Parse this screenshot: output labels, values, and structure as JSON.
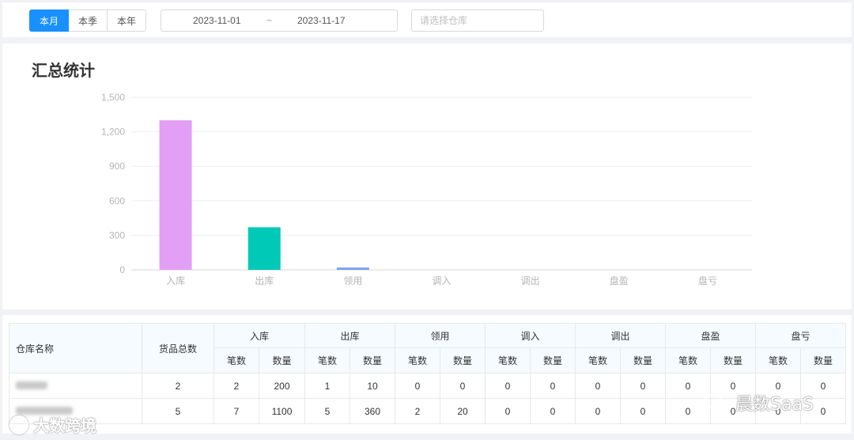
{
  "toolbar": {
    "periods": [
      {
        "label": "本月",
        "active": true
      },
      {
        "label": "本季",
        "active": false
      },
      {
        "label": "本年",
        "active": false
      }
    ],
    "date_start": "2023-11-01",
    "date_separator": "~",
    "date_end": "2023-11-17",
    "warehouse_placeholder": "请选择仓库"
  },
  "summary": {
    "title": "汇总统计"
  },
  "chart_data": {
    "type": "bar",
    "categories": [
      "入库",
      "出库",
      "领用",
      "调入",
      "调出",
      "盘盈",
      "盘亏"
    ],
    "values": [
      1300,
      370,
      20,
      0,
      0,
      0,
      0
    ],
    "colors": [
      "#e39ff6",
      "#00c9b8",
      "#7e9ff2",
      "#e39ff6",
      "#e39ff6",
      "#e39ff6",
      "#e39ff6"
    ],
    "ylim": [
      0,
      1500
    ],
    "yticks": [
      0,
      300,
      600,
      900,
      1200,
      1500
    ],
    "ytick_labels": [
      "0",
      "300",
      "600",
      "900",
      "1,200",
      "1,500"
    ],
    "grid": true,
    "title": "",
    "xlabel": "",
    "ylabel": ""
  },
  "table": {
    "col_name": "仓库名称",
    "col_total": "货品总数",
    "groups": [
      "入库",
      "出库",
      "领用",
      "调入",
      "调出",
      "盘盈",
      "盘亏"
    ],
    "sub_count": "笔数",
    "sub_qty": "数量",
    "rows": [
      {
        "total": "2",
        "cells": [
          "2",
          "200",
          "1",
          "10",
          "0",
          "0",
          "0",
          "0",
          "0",
          "0",
          "0",
          "0",
          "0",
          "0"
        ]
      },
      {
        "total": "5",
        "cells": [
          "7",
          "1100",
          "5",
          "360",
          "2",
          "20",
          "0",
          "0",
          "0",
          "0",
          "0",
          "0",
          "0",
          "0"
        ]
      }
    ]
  },
  "watermarks": {
    "left": "大数跨境",
    "right": "晨数SaaS"
  }
}
